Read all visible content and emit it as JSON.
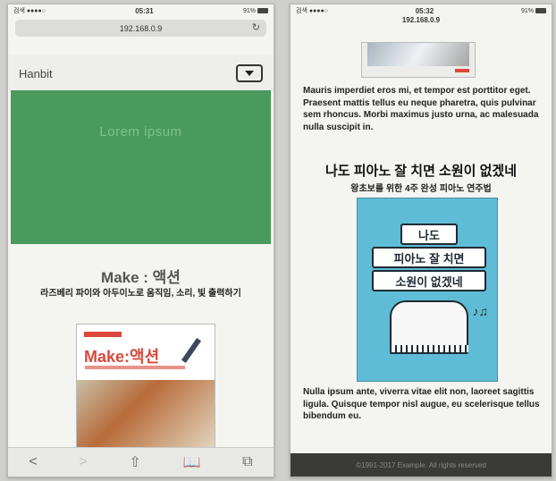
{
  "left_phone": {
    "status": {
      "carrier": "검색 ●●●●○",
      "time": "05:31",
      "right": "91%"
    },
    "address_bar": {
      "url": "192.168.0.9",
      "reload_icon": "reload-icon"
    },
    "navbar": {
      "brand": "Hanbit",
      "toggle_icon": "dropdown-icon"
    },
    "hero": {
      "title": "Lorem ipsum"
    },
    "book": {
      "title": "Make : 액션",
      "subtitle": "라즈베리 파이와 아두이노로 움직임, 소리, 빛 출력하기",
      "cover_title": "Make:액션"
    },
    "toolbar": {
      "back": "<",
      "forward": ">",
      "share": "⇧",
      "bookmarks": "⧉",
      "tabs": "⧉"
    }
  },
  "right_phone": {
    "status": {
      "carrier": "검색 ●●●●○",
      "time": "05:32",
      "right": "91%"
    },
    "url": "192.168.0.9",
    "paragraph1": "Mauris imperdiet eros mi, et tempor est porttitor eget. Praesent mattis tellus eu neque pharetra, quis pulvinar sem rhoncus. Morbi maximus justo urna, ac malesuada nulla suscipit in.",
    "book": {
      "title": "나도 피아노 잘 치면 소원이 없겠네",
      "subtitle": "왕초보를 위한 4주 완성 피아노 연주법",
      "cover_line1": "나도",
      "cover_line2": "피아노 잘 치면",
      "cover_line3": "소원이 없겠네"
    },
    "paragraph2": "Nulla ipsum ante, viverra vitae elit non, laoreet sagittis ligula. Quisque tempor nisl augue, eu scelerisque tellus bibendum eu.",
    "footer": "©1991-2017 Example. All rights reserved"
  }
}
